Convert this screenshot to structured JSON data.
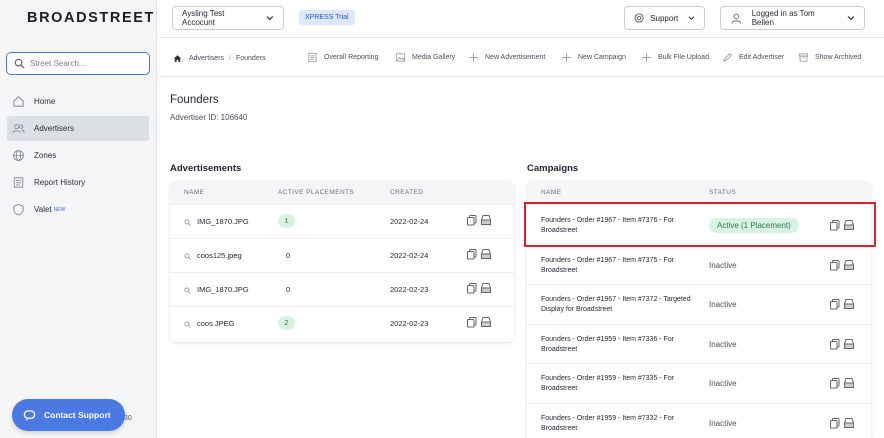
{
  "sidebar": {
    "logo": "BROADSTREET",
    "search_placeholder": "Street Search...",
    "nav": [
      {
        "label": "Home",
        "icon": "home-icon"
      },
      {
        "label": "Advertisers",
        "icon": "users-icon",
        "active": true
      },
      {
        "label": "Zones",
        "icon": "globe-icon"
      },
      {
        "label": "Report History",
        "icon": "report-icon"
      },
      {
        "label": "Valet",
        "icon": "shield-icon",
        "badge": "NEW"
      }
    ],
    "contact_label": "Contact Support",
    "footer_text": "30"
  },
  "topbar": {
    "account_label": "Aysling Test Accocunt",
    "trial_badge": "XPRESS Trial",
    "support_label": "Support",
    "user_label": "Logged in as Tom Bellen"
  },
  "breadcrumb": [
    "Advertisers",
    "Founders"
  ],
  "actions": [
    "Overall Reporting",
    "Media Gallery",
    "New Advertisement",
    "New Campaign",
    "Bulk File Upload",
    "Edit Advertiser",
    "Show Archived"
  ],
  "advertiser": {
    "name": "Founders",
    "id_label": "Advertiser ID: 106640"
  },
  "advertisements": {
    "title": "Advertisements",
    "columns": [
      "NAME",
      "ACTIVE PLACEMENTS",
      "CREATED"
    ],
    "rows": [
      {
        "name": "IMG_1870.JPG",
        "placements": "1",
        "active": true,
        "created": "2022-02-24"
      },
      {
        "name": "coos125.jpeg",
        "placements": "0",
        "active": false,
        "created": "2022-02-24"
      },
      {
        "name": "IMG_1870.JPG",
        "placements": "0",
        "active": false,
        "created": "2022-02-23"
      },
      {
        "name": "coos.JPEG",
        "placements": "2",
        "active": true,
        "created": "2022-02-23"
      }
    ]
  },
  "campaigns": {
    "title": "Campaigns",
    "columns": [
      "NAME",
      "STATUS"
    ],
    "rows": [
      {
        "name": "Founders - Order #1967 - Item #7376 - For Broadstreet",
        "status": "Active (1 Placement)",
        "active": true
      },
      {
        "name": "Founders - Order #1967 - Item #7375 - For Broadstreet",
        "status": "Inactive",
        "active": false
      },
      {
        "name": "Founders - Order #1967 - Item #7372 - Targeted Display for Broadstreet",
        "status": "Inactive",
        "active": false
      },
      {
        "name": "Founders - Order #1959 - Item #7336 - For Broadstreet",
        "status": "Inactive",
        "active": false
      },
      {
        "name": "Founders - Order #1959 - Item #7335 - For Broadstreet",
        "status": "Inactive",
        "active": false
      },
      {
        "name": "Founders - Order #1959 - Item #7332 - For Broadstreet",
        "status": "Inactive",
        "active": false
      }
    ]
  },
  "colors": {
    "accent": "#4b79e3",
    "active_pill": "#d9f3e3",
    "highlight": "#d6262b"
  }
}
